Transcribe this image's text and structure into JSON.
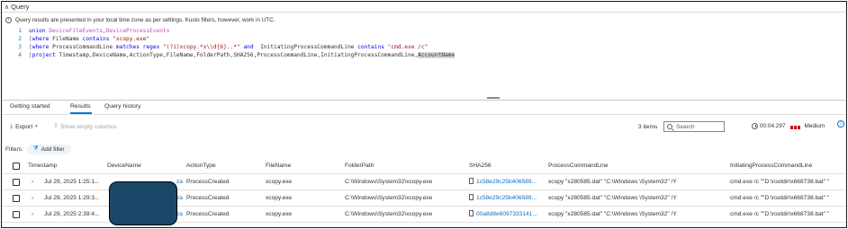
{
  "query_panel": {
    "title": "Query",
    "info": "Query results are presented in your local time zone as per settings. Kusto filters, however, work in UTC.",
    "lines": [
      {
        "n": "1",
        "segments": [
          {
            "t": "union ",
            "c": "kw"
          },
          {
            "t": "DeviceFileEvents",
            "c": "tb"
          },
          {
            "t": ",",
            "c": "plain"
          },
          {
            "t": "DeviceProcessEvents",
            "c": "tb"
          }
        ]
      },
      {
        "n": "2",
        "segments": [
          {
            "t": "|",
            "c": "pipe"
          },
          {
            "t": "where ",
            "c": "kw"
          },
          {
            "t": "FileName ",
            "c": "ident"
          },
          {
            "t": "contains ",
            "c": "kw"
          },
          {
            "t": "\"xcopy.exe\"",
            "c": "str"
          }
        ]
      },
      {
        "n": "3",
        "segments": [
          {
            "t": "|",
            "c": "pipe"
          },
          {
            "t": "where ",
            "c": "kw"
          },
          {
            "t": "ProcessCommandLine ",
            "c": "ident"
          },
          {
            "t": "matches regex ",
            "c": "kw"
          },
          {
            "t": "\"(?i)xcopy.*x\\\\d{6}..*\"",
            "c": "str"
          },
          {
            "t": " and ",
            "c": "kw"
          },
          {
            "t": " InitiatingProcessCommandLine ",
            "c": "ident"
          },
          {
            "t": "contains ",
            "c": "kw"
          },
          {
            "t": "\"cmd.exe /c\"",
            "c": "str"
          }
        ]
      },
      {
        "n": "4",
        "segments": [
          {
            "t": "|",
            "c": "pipe"
          },
          {
            "t": "project ",
            "c": "kw"
          },
          {
            "t": "Timestamp,DeviceName,ActionType,FileName,FolderPath,SHA256,ProcessCommandLine,InitiatingProcessCommandLine,",
            "c": "ident"
          },
          {
            "t": "AccountName",
            "c": "ident highlight"
          }
        ]
      }
    ]
  },
  "tabs": {
    "getting_started": "Getting started",
    "results": "Results",
    "query_history": "Query history"
  },
  "toolbar": {
    "export": "Export",
    "show_empty": "Show empty columns",
    "items_count": "3 items",
    "search_placeholder": "Search",
    "elapsed": "00:04.297",
    "level": "Medium"
  },
  "filters": {
    "label": "Filters:",
    "add_filter": "Add filter"
  },
  "table": {
    "columns": [
      "Timestamp",
      "DeviceName",
      "ActionType",
      "FileName",
      "FolderPath",
      "SHA256",
      "ProcessCommandLine",
      "InitiatingProcessCommandLine"
    ],
    "rows": [
      {
        "timestamp": "Jul 29, 2025 1:25:1...",
        "device": "za",
        "action": "ProcessCreated",
        "file": "xcopy.exe",
        "folder": "C:\\Windows\\System32\\xcopy.exe",
        "sha": "1c58e29c25b406589...",
        "pcl": "xcopy \"x280585.dat\" \"C:\\Windows \\System32\" /Y",
        "ipcl": "cmd.exe /c \"\"D:\\rootdir\\x668738.bat\" \""
      },
      {
        "timestamp": "Jul 29, 2025 1:29:3...",
        "device": "za",
        "action": "ProcessCreated",
        "file": "xcopy.exe",
        "folder": "C:\\Windows\\System32\\xcopy.exe",
        "sha": "1c58e29c25b406589...",
        "pcl": "xcopy \"x280585.dat\" \"C:\\Windows \\System32\" /Y",
        "ipcl": "cmd.exe /c \"\"D:\\rootdir\\x668738.bat\" \""
      },
      {
        "timestamp": "Jul 29, 2025 2:39:4...",
        "device": "za",
        "action": "ProcessCreated",
        "file": "xcopy.exe",
        "folder": "C:\\Windows\\System32\\xcopy.exe",
        "sha": "00a8d8e6097333141...",
        "pcl": "xcopy \"x280585.dat\" \"C:\\Windows \\System32\" /Y",
        "ipcl": "cmd.exe /c \"\"D:\\rootdir\\x668738.bat\" \""
      }
    ]
  },
  "icons": {
    "collapse": "chevron-up-icon",
    "info": "info-icon",
    "export": "download-icon",
    "columns": "columns-icon",
    "search": "search-icon",
    "clock": "clock-icon",
    "severity": "severity-bars-icon",
    "help": "info-icon",
    "filter": "filter-icon",
    "expand": "chevron-right-icon",
    "file": "file-icon"
  },
  "colors": {
    "accent": "#0078d4",
    "link": "#0f6cbd",
    "severity": "#c50f1f",
    "keyword": "#0000ff",
    "table_name": "#c050c0",
    "string": "#a31515",
    "redaction": "#1b4868"
  }
}
